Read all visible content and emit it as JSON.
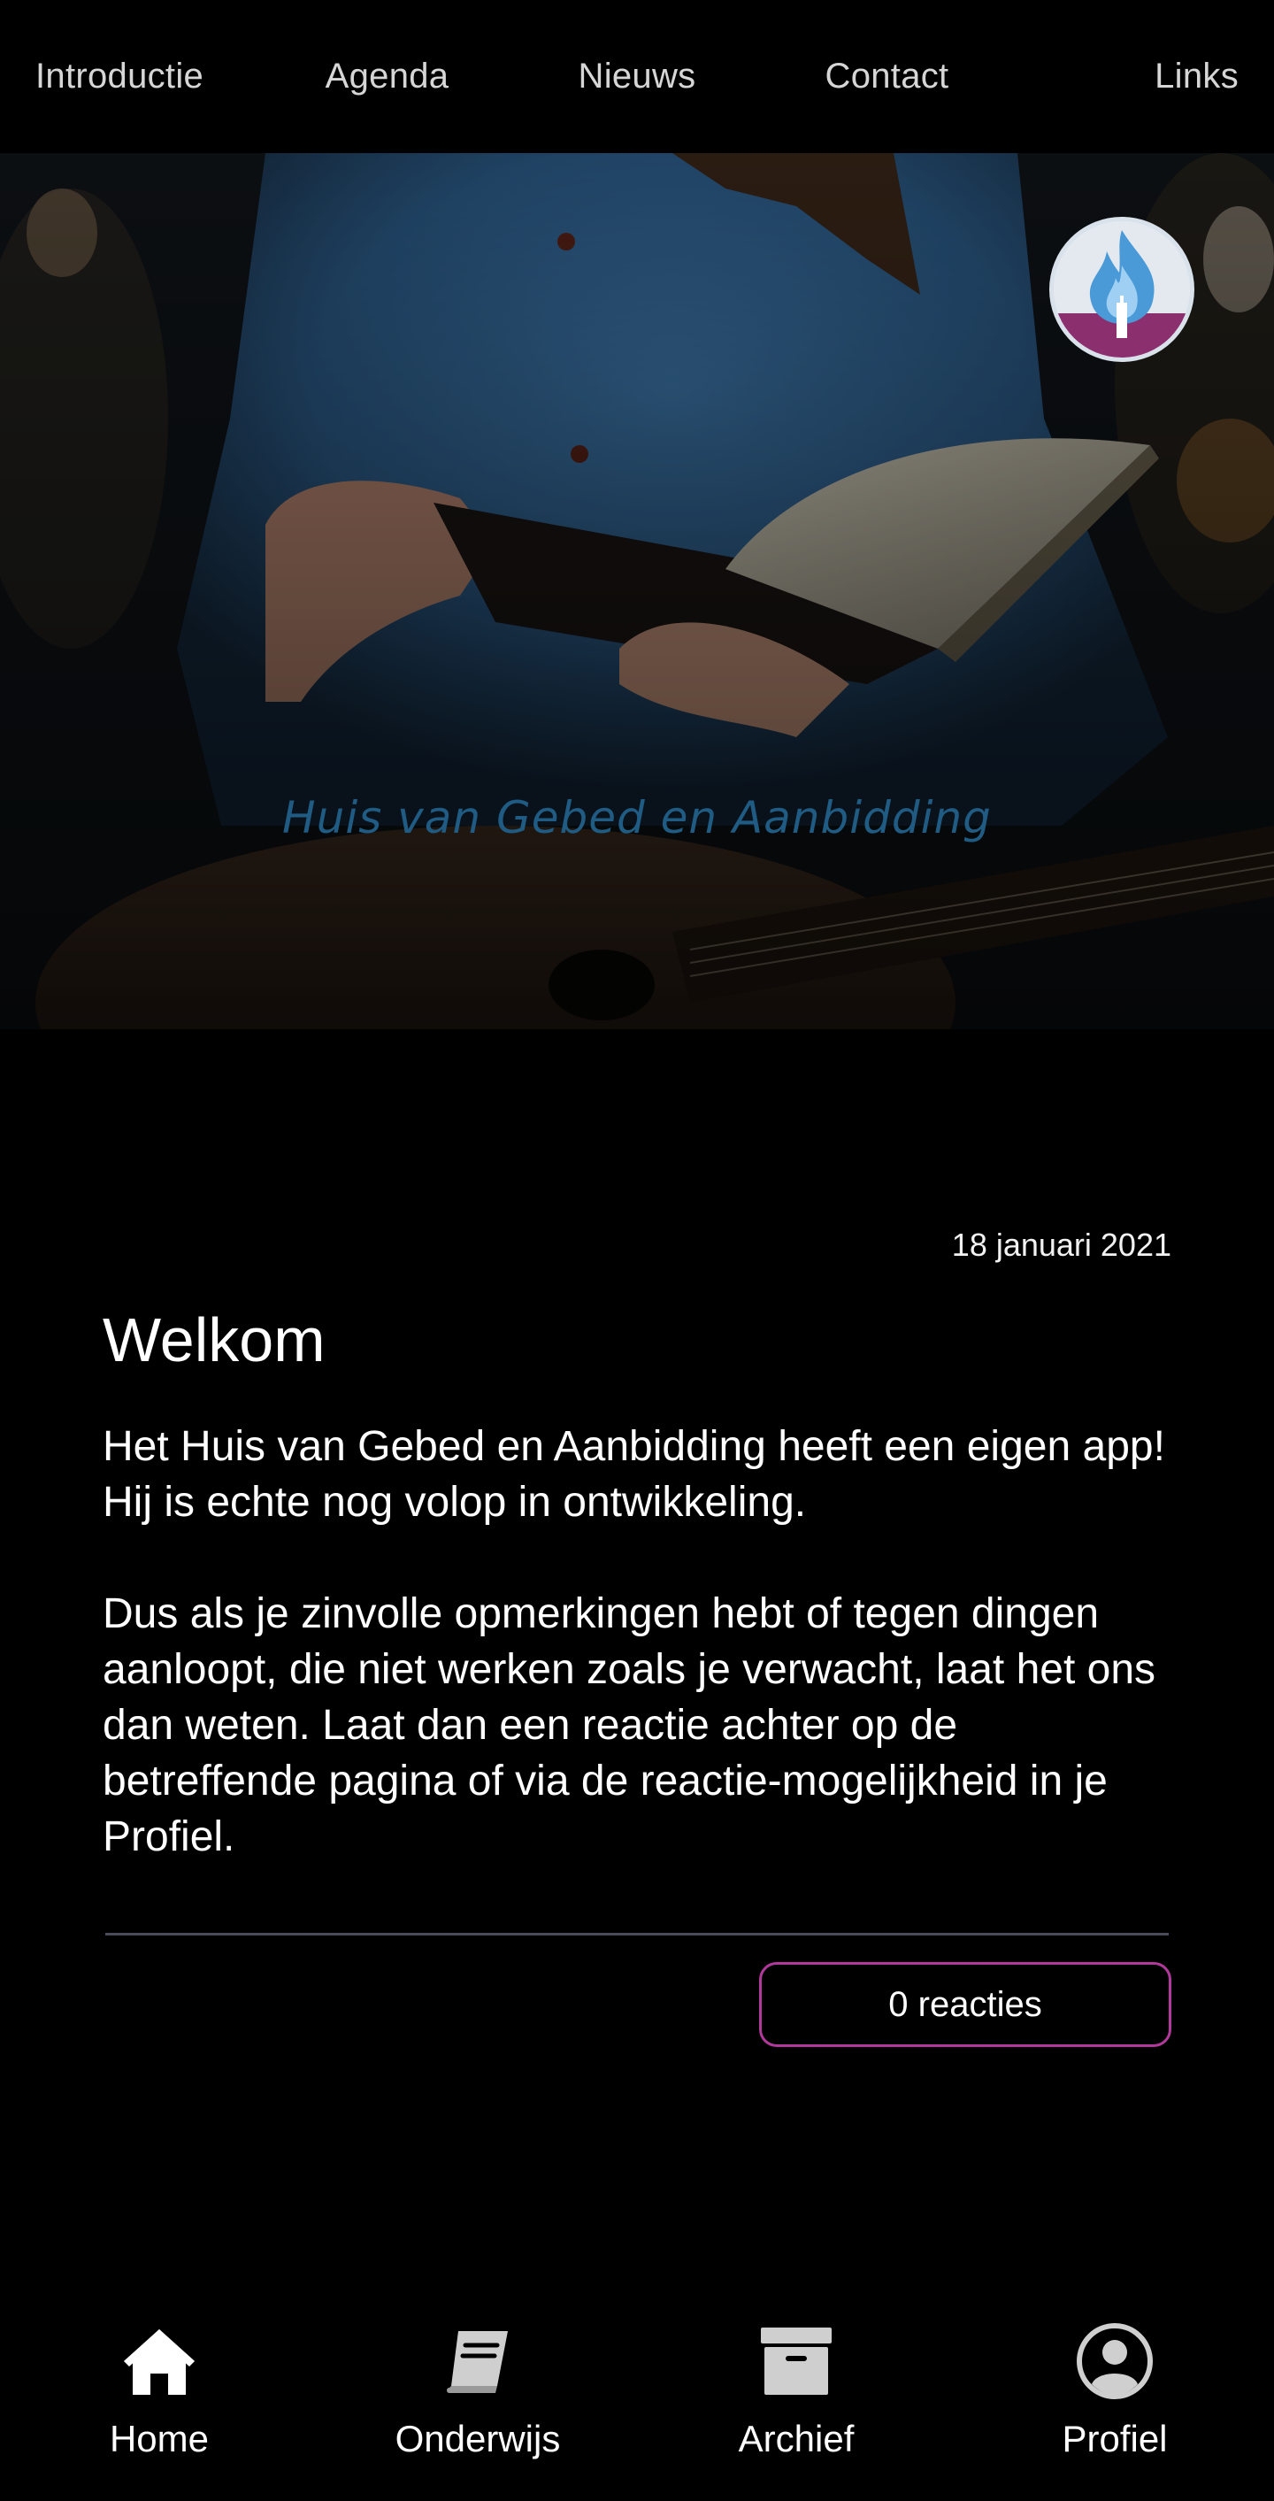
{
  "top_nav": {
    "items": [
      {
        "label": "Introductie"
      },
      {
        "label": "Agenda"
      },
      {
        "label": "Nieuws"
      },
      {
        "label": "Contact"
      },
      {
        "label": "Links"
      }
    ]
  },
  "hero": {
    "title": "Huis van Gebed en Aanbidding",
    "logo_icon": "flame-candle-logo"
  },
  "post": {
    "date": "18 januari 2021",
    "title": "Welkom",
    "paragraphs": [
      "Het Huis van Gebed en Aanbidding heeft een eigen app! Hij is echte nog volop in ontwikkeling.",
      "Dus als je zinvolle opmerkingen hebt of tegen dingen aanloopt, die niet werken zoals je verwacht, laat het ons dan weten. Laat dan een reactie achter op de betreffende pagina of via de reactie-mogelijkheid in je Profiel."
    ],
    "reactions_label": "0 reacties"
  },
  "bottom_nav": {
    "tabs": [
      {
        "label": "Home",
        "icon": "home-icon"
      },
      {
        "label": "Onderwijs",
        "icon": "book-icon"
      },
      {
        "label": "Archief",
        "icon": "archive-box-icon"
      },
      {
        "label": "Profiel",
        "icon": "user-circle-icon"
      }
    ],
    "active": "Home"
  },
  "colors": {
    "background": "#000000",
    "accent_border": "#b0399b",
    "divider": "#4a4a5a",
    "hero_title": "#1f5b82",
    "nav_text": "#d6d6d6"
  }
}
